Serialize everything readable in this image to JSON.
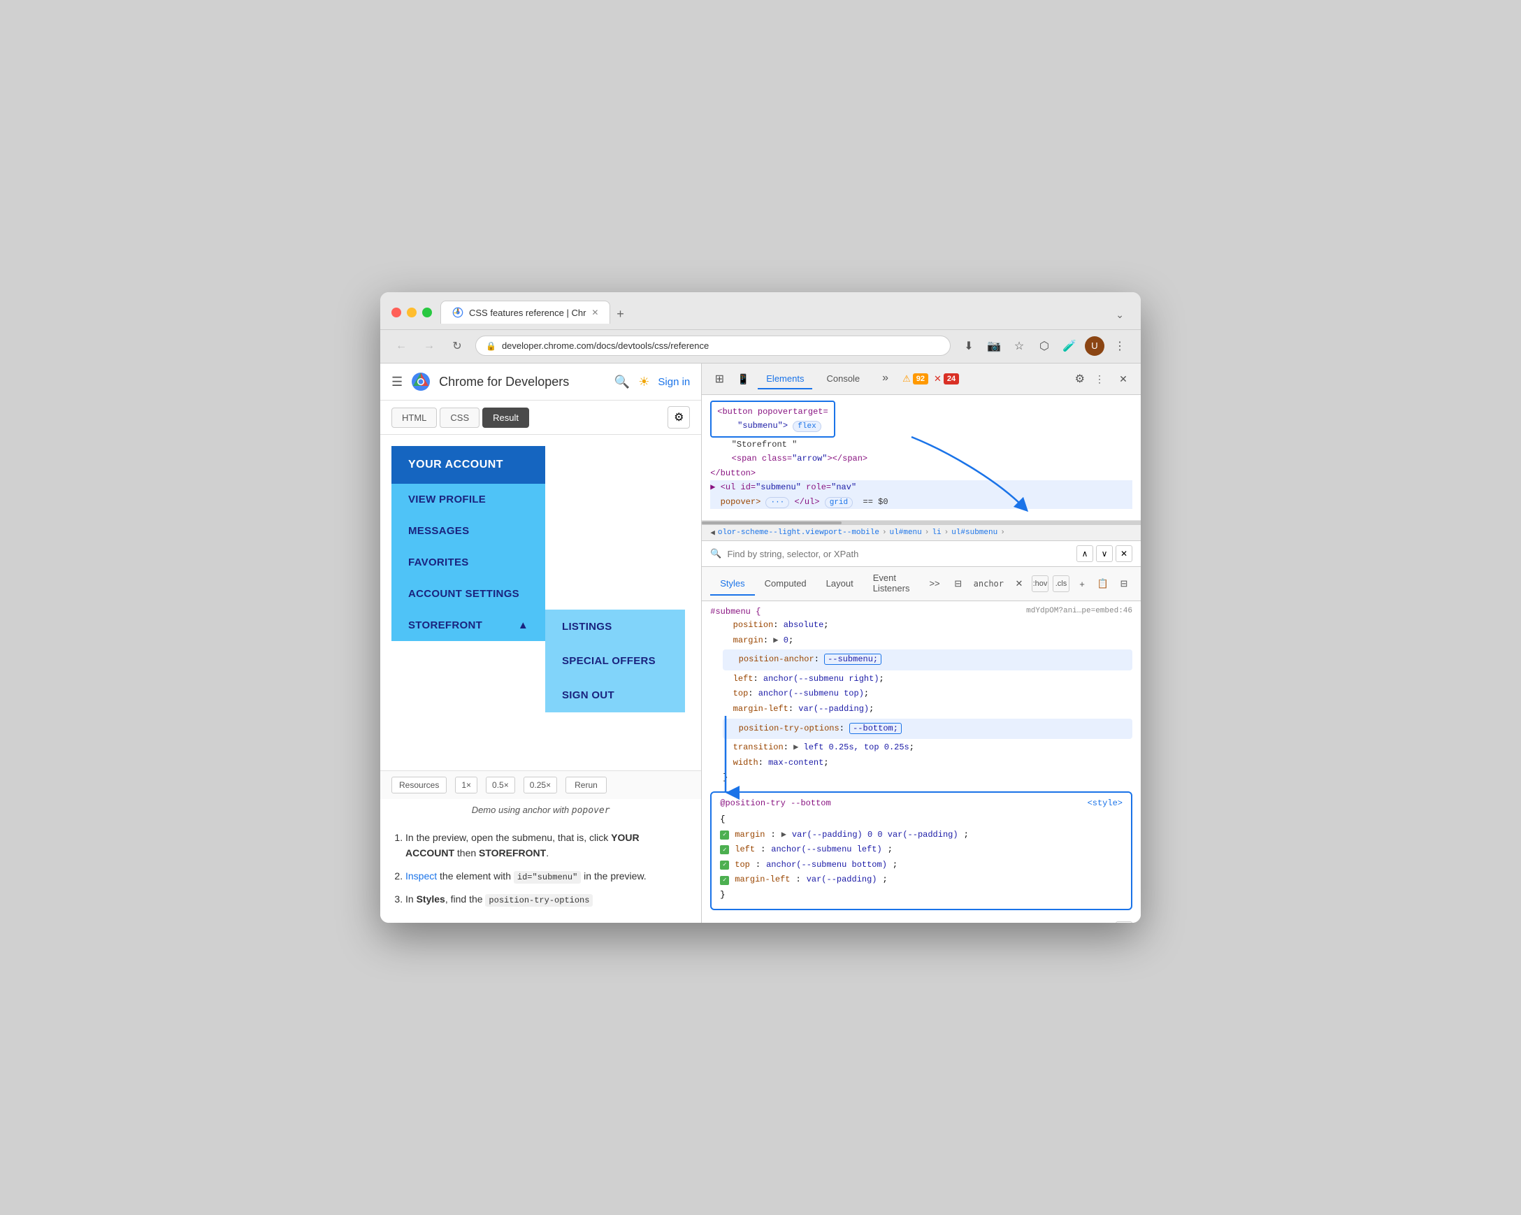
{
  "window": {
    "title": "CSS features reference | Chr",
    "url": "developer.chrome.com/docs/devtools/css/reference"
  },
  "browser": {
    "tab_title": "CSS features reference | Chr",
    "back_disabled": false,
    "forward_disabled": false
  },
  "chrome_header": {
    "title": "Chrome for Developers",
    "signin": "Sign in"
  },
  "code_tabs": {
    "html": "HTML",
    "css": "CSS",
    "result": "Result"
  },
  "demo": {
    "your_account": "YOUR ACCOUNT",
    "menu_items": [
      "VIEW PROFILE",
      "MESSAGES",
      "FAVORITES",
      "ACCOUNT SETTINGS",
      "STOREFRONT"
    ],
    "storefront_arrow": "▲",
    "submenu_items": [
      "LISTINGS",
      "SPECIAL OFFERS",
      "SIGN OUT"
    ],
    "resources": "Resources",
    "scales": [
      "1×",
      "0.5×",
      "0.25×"
    ],
    "rerun": "Rerun",
    "caption": "Demo using anchor with  popover"
  },
  "instructions": {
    "step1_pre": "In the preview, open the submenu, that is, click ",
    "step1_bold1": "YOUR ACCOUNT",
    "step1_mid": " then ",
    "step1_bold2": "STOREFRONT",
    "step1_end": ".",
    "step2_pre": "the element with ",
    "step2_code": "id=\"submenu\"",
    "step2_post": " in the preview.",
    "step2_link": "Inspect",
    "step3_pre": "In ",
    "step3_bold": "Styles",
    "step3_post": ", find the ",
    "step3_code": "position-try-options"
  },
  "devtools": {
    "tabs": [
      "Elements",
      "Console",
      "more_tabs"
    ],
    "active_tab": "Elements",
    "warnings": "92",
    "errors": "24",
    "html_content": {
      "line1_pre": "<button popovertarget=",
      "line1_post": "\"submenu\">",
      "line1_chip": "flex",
      "line2": "\"Storefront \"",
      "line3": "<span class=\"arrow\"></span>",
      "line4": "</button>",
      "line5_pre": "<ul id=\"submenu\" role=\"nav\"",
      "line6_pre": "popover>",
      "line6_chip": "···",
      "line6_post": "</ul>",
      "line6_chip2": "grid",
      "line6_dollar": "== $0"
    },
    "breadcrumb": {
      "items": [
        "olor-scheme--light.viewport--mobile",
        "ul#menu",
        "li",
        "ul#submenu"
      ]
    },
    "filter": {
      "placeholder": "Find by string, selector, or XPath"
    },
    "style_tabs": [
      "Styles",
      "Computed",
      "Layout",
      "Event Listeners",
      "more"
    ],
    "active_style_tab": "Styles",
    "filter_anchor": "anchor",
    "pseudo_classes": [
      ":hov",
      ".cls"
    ],
    "css_content": {
      "selector": "#submenu {",
      "source": "mdYdpOM?ani…pe=embed:46",
      "props": [
        {
          "prop": "position",
          "val": "absolute"
        },
        {
          "prop": "margin",
          "val": "▶ 0"
        },
        {
          "prop": "position-anchor",
          "val": "--submenu",
          "highlight": true
        },
        {
          "prop": "left",
          "val": "anchor(--submenu right)"
        },
        {
          "prop": "top",
          "val": "anchor(--submenu top)"
        },
        {
          "prop": "margin-left",
          "val": "var(--padding)"
        },
        {
          "prop": "position-try-options",
          "val": "--bottom",
          "highlight": true
        },
        {
          "prop": "transition",
          "val": "▶ left 0.25s, top 0.25s"
        },
        {
          "prop": "width",
          "val": "max-content"
        }
      ]
    },
    "at_rule": {
      "name": "@position-try --bottom",
      "source": "<style>",
      "props": [
        {
          "prop": "margin",
          "val": "▶ var(--padding) 0 0 var(--padding)"
        },
        {
          "prop": "left",
          "val": "anchor(--submenu left)"
        },
        {
          "prop": "top",
          "val": "anchor(--submenu bottom)"
        },
        {
          "prop": "margin-left",
          "val": "var(--padding)"
        }
      ]
    }
  }
}
